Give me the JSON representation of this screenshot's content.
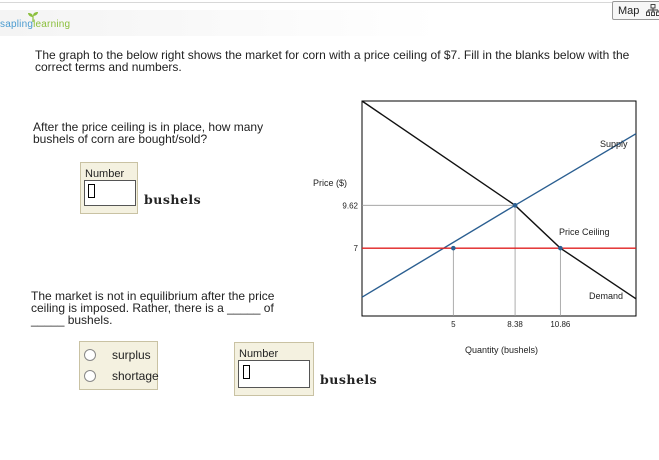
{
  "header": {
    "logo_part1": "sapling",
    "logo_part2": "learning",
    "map_label": "Map"
  },
  "question": {
    "intro": "The graph to the below right shows the market for corn with a price ceiling of $7. Fill in the blanks below with the correct terms and numbers."
  },
  "part1": {
    "prompt": "After the price ceiling is in place, how many bushels of corn are bought/sold?",
    "number_label": "Number",
    "number_value": "",
    "unit": "bushels"
  },
  "part2": {
    "prompt": "The market is not in equilibrium after the price ceiling is imposed. Rather, there is a _____ of _____ bushels.",
    "options": [
      "surplus",
      "shortage"
    ],
    "number_label": "Number",
    "number_value": "",
    "unit": "bushels"
  },
  "chart_data": {
    "type": "line",
    "title": "",
    "xlabel": "Quantity (bushels)",
    "ylabel": "Price ($)",
    "x_ticks": [
      "5",
      "8.38",
      "10.86"
    ],
    "y_ticks": [
      "9.62",
      "7"
    ],
    "series": [
      {
        "name": "Supply",
        "points": [
          [
            0,
            4.0
          ],
          [
            8.38,
            9.62
          ],
          [
            15,
            14.0
          ]
        ]
      },
      {
        "name": "Demand",
        "points": [
          [
            0,
            16.0
          ],
          [
            8.38,
            9.62
          ],
          [
            10.86,
            7
          ],
          [
            15,
            3.9
          ]
        ]
      },
      {
        "name": "Price Ceiling",
        "points": [
          [
            0,
            7
          ],
          [
            15,
            7
          ]
        ]
      }
    ],
    "key_points": [
      {
        "x": 8.38,
        "y": 9.62
      },
      {
        "x": 5,
        "y": 7
      },
      {
        "x": 10.86,
        "y": 7
      }
    ],
    "colors": {
      "supply": "#2b5f91",
      "demand": "#111111",
      "ceiling": "#e02020",
      "guides": "#999999",
      "points": "#2b5f91"
    }
  }
}
